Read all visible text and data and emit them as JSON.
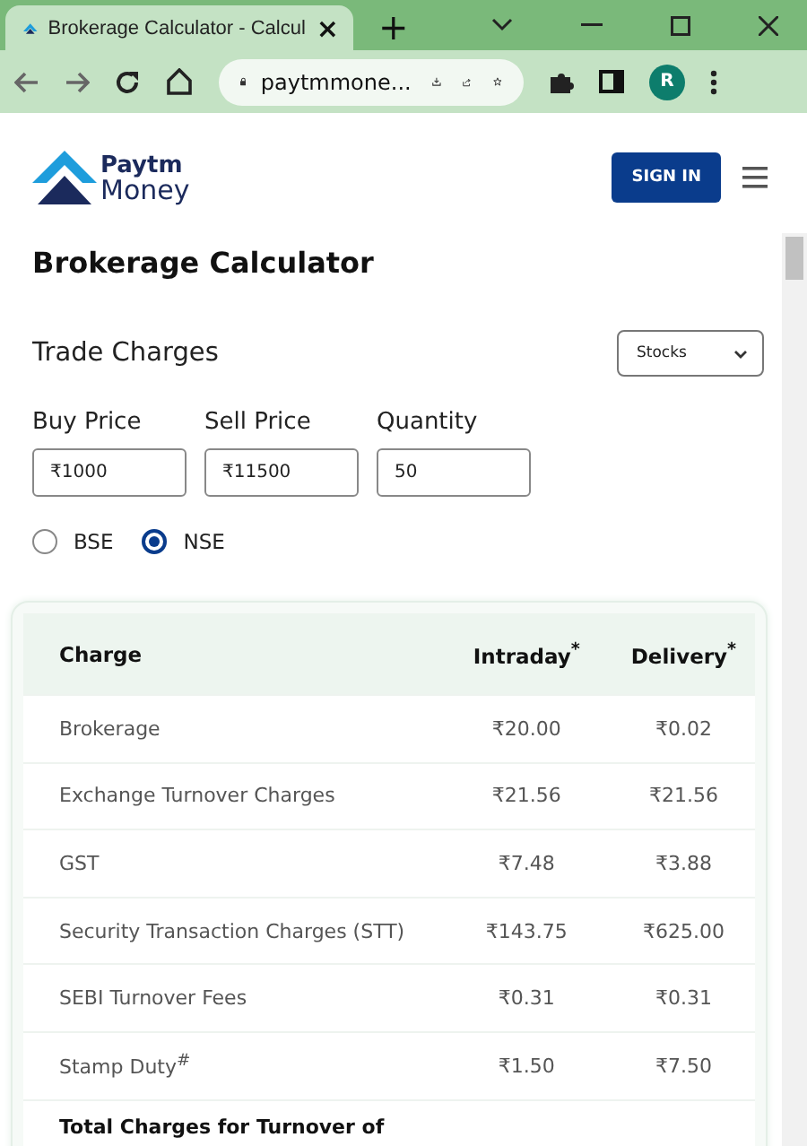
{
  "browser": {
    "tab_title": "Brokerage Calculator - Calcul",
    "close": "×",
    "new_tab": "+",
    "address": "paytmmone...",
    "profile": "R"
  },
  "header": {
    "logo_top": "Paytm",
    "logo_bottom": "Money",
    "sign_in": "SIGN IN"
  },
  "page_title": "Brokerage Calculator",
  "trade": {
    "title": "Trade Charges",
    "segment": "Stocks"
  },
  "fields": [
    {
      "label": "Buy Price",
      "value": "₹1000"
    },
    {
      "label": "Sell Price",
      "value": "₹11500"
    },
    {
      "label": "Quantity",
      "value": "50"
    }
  ],
  "exchanges": [
    {
      "label": "BSE",
      "selected": false
    },
    {
      "label": "NSE",
      "selected": true
    }
  ],
  "table": {
    "columns": [
      "Charge",
      "Intraday$^{*}$",
      "Delivery$^{*}$"
    ],
    "rows": [
      {
        "charge": "Brokerage",
        "intraday": "₹20.00",
        "delivery": "₹0.02"
      },
      {
        "charge": "Exchange Turnover Charges",
        "intraday": "₹21.56",
        "delivery": "₹21.56"
      },
      {
        "charge": "GST",
        "intraday": "₹7.48",
        "delivery": "₹3.88"
      },
      {
        "charge": "Security Transaction Charges (STT)",
        "intraday": "₹143.75",
        "delivery": "₹625.00"
      },
      {
        "charge": "SEBI Turnover Fees",
        "intraday": "₹0.31",
        "delivery": "₹0.31"
      },
      {
        "charge": "Stamp Duty$^{#}$",
        "intraday": "₹1.50",
        "delivery": "₹7.50"
      }
    ],
    "total_label": "Total Charges for Turnover of"
  }
}
